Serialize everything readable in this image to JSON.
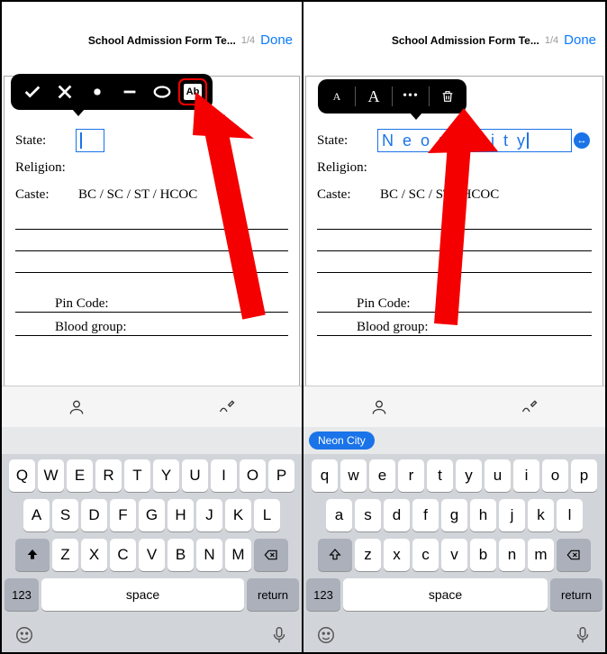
{
  "left": {
    "header": {
      "title": "School Admission Form Te...",
      "page": "1/4",
      "done": "Done"
    },
    "tools": {
      "check": "check",
      "x": "x",
      "dot": "dot",
      "dash": "dash",
      "oval": "oval",
      "ab": "Ab"
    },
    "doc": {
      "state_label": "State:",
      "religion_label": "Religion:",
      "caste_label": "Caste:",
      "caste_value": "BC / SC / ST / HCOC",
      "pincode_label": "Pin Code:",
      "blood_label": "Blood group:"
    },
    "textbox_value": "",
    "keyboard": {
      "row1": [
        "Q",
        "W",
        "E",
        "R",
        "T",
        "Y",
        "U",
        "I",
        "O",
        "P"
      ],
      "row2": [
        "A",
        "S",
        "D",
        "F",
        "G",
        "H",
        "J",
        "K",
        "L"
      ],
      "row3": [
        "Z",
        "X",
        "C",
        "V",
        "B",
        "N",
        "M"
      ],
      "num": "123",
      "space": "space",
      "return": "return"
    }
  },
  "right": {
    "header": {
      "title": "School Admission Form Te...",
      "page": "1/4",
      "done": "Done"
    },
    "tools": {
      "smallA": "A",
      "bigA": "A",
      "dots": "•••",
      "trash": "trash"
    },
    "doc": {
      "state_label": "State:",
      "religion_label": "Religion:",
      "caste_label": "Caste:",
      "caste_value": "BC / SC / ST / HCOC",
      "pincode_label": "Pin Code:",
      "blood_label": "Blood group:"
    },
    "textbox_value": "Neon City",
    "suggestion_pill": "Neon City",
    "keyboard": {
      "row1": [
        "q",
        "w",
        "e",
        "r",
        "t",
        "y",
        "u",
        "i",
        "o",
        "p"
      ],
      "row2": [
        "a",
        "s",
        "d",
        "f",
        "g",
        "h",
        "j",
        "k",
        "l"
      ],
      "row3": [
        "z",
        "x",
        "c",
        "v",
        "b",
        "n",
        "m"
      ],
      "num": "123",
      "space": "space",
      "return": "return"
    }
  }
}
